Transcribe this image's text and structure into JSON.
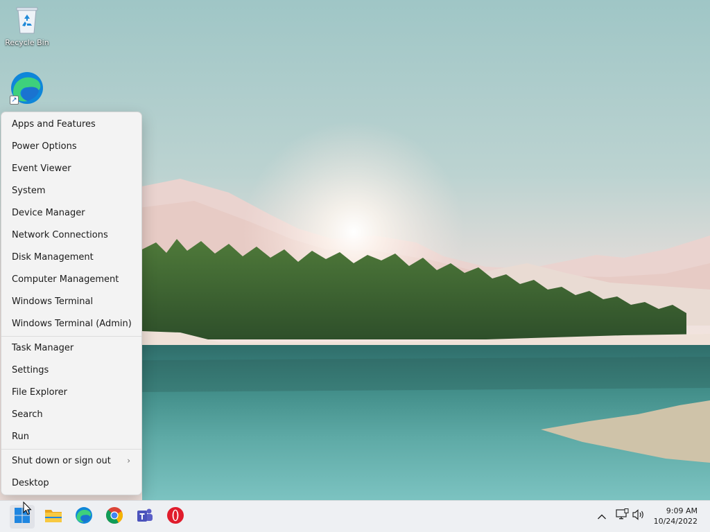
{
  "desktop": {
    "icons": [
      {
        "label": "Recycle Bin",
        "icon": "recycle-bin-icon"
      },
      {
        "label": "",
        "icon": "edge-icon"
      }
    ]
  },
  "context_menu": {
    "items": [
      "Apps and Features",
      "Power Options",
      "Event Viewer",
      "System",
      "Device Manager",
      "Network Connections",
      "Disk Management",
      "Computer Management",
      "Windows Terminal",
      "Windows Terminal (Admin)",
      "Task Manager",
      "Settings",
      "File Explorer",
      "Search",
      "Run",
      "Shut down or sign out",
      "Desktop"
    ],
    "submenu_chevron": "›"
  },
  "taskbar": {
    "pinned": [
      {
        "icon": "windows-start-icon"
      },
      {
        "icon": "file-explorer-icon"
      },
      {
        "icon": "edge-icon"
      },
      {
        "icon": "chrome-icon"
      },
      {
        "icon": "teams-icon"
      },
      {
        "icon": "opera-icon"
      }
    ],
    "tray": {
      "overflow_chevron": "^",
      "time": "9:09 AM",
      "date": "10/24/2022"
    }
  },
  "colors": {
    "accent": "#0067c0",
    "menu_bg": "#f3f3f3",
    "taskbar_bg": "#eef0f3"
  }
}
